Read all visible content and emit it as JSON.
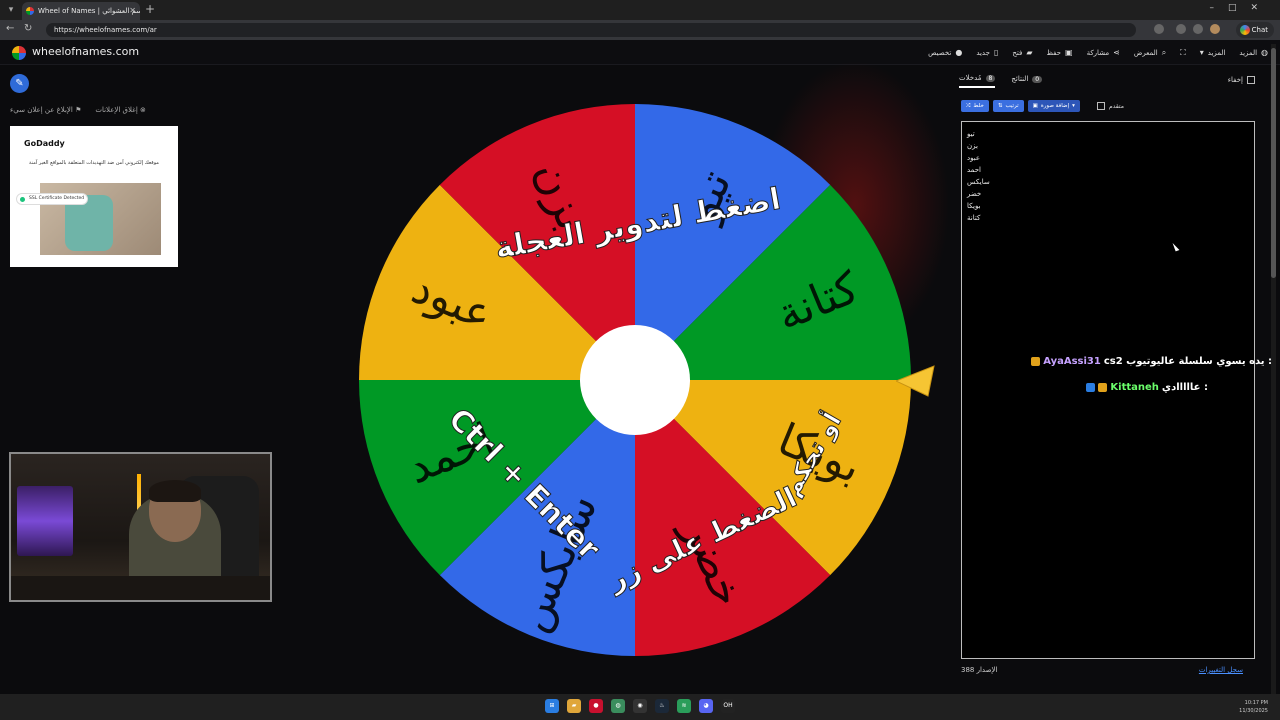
{
  "browser": {
    "tab_title": "Wheel of Names | الاسم العشوائي ...",
    "url": "https://wheelofnames.com/ar",
    "chat_label": "Chat"
  },
  "header": {
    "site_name": "wheelofnames.com",
    "menu": [
      {
        "label": "المزيد",
        "icon": "globe-icon"
      },
      {
        "label": "المزيد",
        "icon": "chevron-down-icon"
      },
      {
        "label": "",
        "icon": "fullscreen-icon"
      },
      {
        "label": "المعرض",
        "icon": "search-icon"
      },
      {
        "label": "مشاركة",
        "icon": "share-icon"
      },
      {
        "label": "حفظ",
        "icon": "save-icon"
      },
      {
        "label": "فتح",
        "icon": "folder-icon"
      },
      {
        "label": "جديد",
        "icon": "file-icon"
      },
      {
        "label": "تخصيص",
        "icon": "palette-icon"
      }
    ]
  },
  "ads": {
    "report_label": "الإبلاغ عن إعلان سيء",
    "close_label": "إغلاق الإعلانات",
    "godaddy_logo": "GoDaddy",
    "godaddy_text": "موقعك إلكتروني آمن ضد التهديدات المتعلقة بالمواقع الغير آمنة",
    "ssl_label": "SSL Certificate Detected"
  },
  "wheel": {
    "segments": [
      {
        "label": "تيو",
        "color": "#3369e8"
      },
      {
        "label": "كتانة",
        "color": "#009925"
      },
      {
        "label": "بويكا",
        "color": "#eeb211"
      },
      {
        "label": "خضر",
        "color": "#d50f25"
      },
      {
        "label": "سايكس",
        "color": "#3369e8"
      },
      {
        "label": "احمد",
        "color": "#009925"
      },
      {
        "label": "عبود",
        "color": "#eeb211"
      },
      {
        "label": "بزن",
        "color": "#d50f25"
      }
    ],
    "overlay_top": "اضغط لتدوير العجلة",
    "overlay_bottom_1": "الضغط على زر",
    "overlay_bottom_2": "Ctrl + Enter",
    "overlay_right": "أو تحكم"
  },
  "panel": {
    "hide_label": "إخفاء",
    "tabs": [
      {
        "label": "مُدخلات",
        "count": "8"
      },
      {
        "label": "النتائج",
        "count": "0"
      }
    ],
    "shuffle_label": "خلط",
    "sort_label": "ترتيب",
    "add_image_label": "إضافة صورة",
    "advanced_label": "متقدم",
    "entries": [
      "تيو",
      "بزن",
      "عبود",
      "احمد",
      "سايكس",
      "خضر",
      "بويكا",
      "كتانة"
    ],
    "version_label": "الإصدار 388",
    "changelog_label": "سجل التغييرات"
  },
  "chat": [
    {
      "user": "AyaAssi31",
      "message": "cs2 يده يسوي سلسلة عاليوتيوب :"
    },
    {
      "user": "Kittaneh",
      "message": "عااااادي :"
    }
  ],
  "taskbar": {
    "time": "10:17 PM",
    "date": "11/30/2025"
  }
}
